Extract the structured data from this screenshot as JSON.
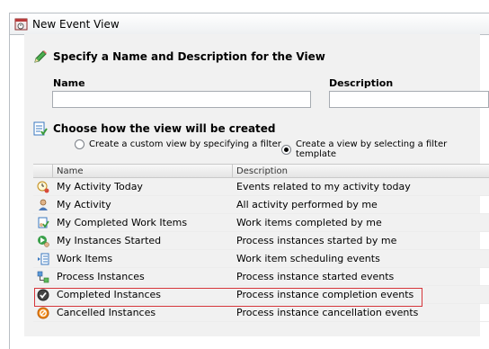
{
  "window": {
    "title": "New Event View"
  },
  "name_section": {
    "heading": "Specify a Name and Description for the View",
    "name_label": "Name",
    "name_value": "",
    "description_label": "Description",
    "description_value": ""
  },
  "create_section": {
    "heading": "Choose how the view will be created",
    "option_custom": "Create a custom view by specifying a filter",
    "option_template": "Create a view by selecting a filter template",
    "selected": "template"
  },
  "table": {
    "headers": {
      "name": "Name",
      "description": "Description"
    },
    "rows": [
      {
        "icon": "activity-clock-icon",
        "name": "My Activity Today",
        "description": "Events related to my activity today"
      },
      {
        "icon": "user-icon",
        "name": "My Activity",
        "description": "All activity performed by me"
      },
      {
        "icon": "completed-work-icon",
        "name": "My Completed Work Items",
        "description": "Work items completed by me"
      },
      {
        "icon": "instance-started-icon",
        "name": "My Instances Started",
        "description": "Process instances started by me"
      },
      {
        "icon": "work-items-icon",
        "name": "Work Items",
        "description": "Work item scheduling events"
      },
      {
        "icon": "process-instances-icon",
        "name": "Process Instances",
        "description": "Process instance started events"
      },
      {
        "icon": "check-circle-icon",
        "name": "Completed Instances",
        "description": "Process instance completion events"
      },
      {
        "icon": "cancel-circle-icon",
        "name": "Cancelled Instances",
        "description": "Process instance cancellation events"
      }
    ],
    "selected_row": "Completed Instances"
  },
  "colors": {
    "highlight_border": "#d6353a",
    "panel_bg": "#f1f1f1"
  }
}
